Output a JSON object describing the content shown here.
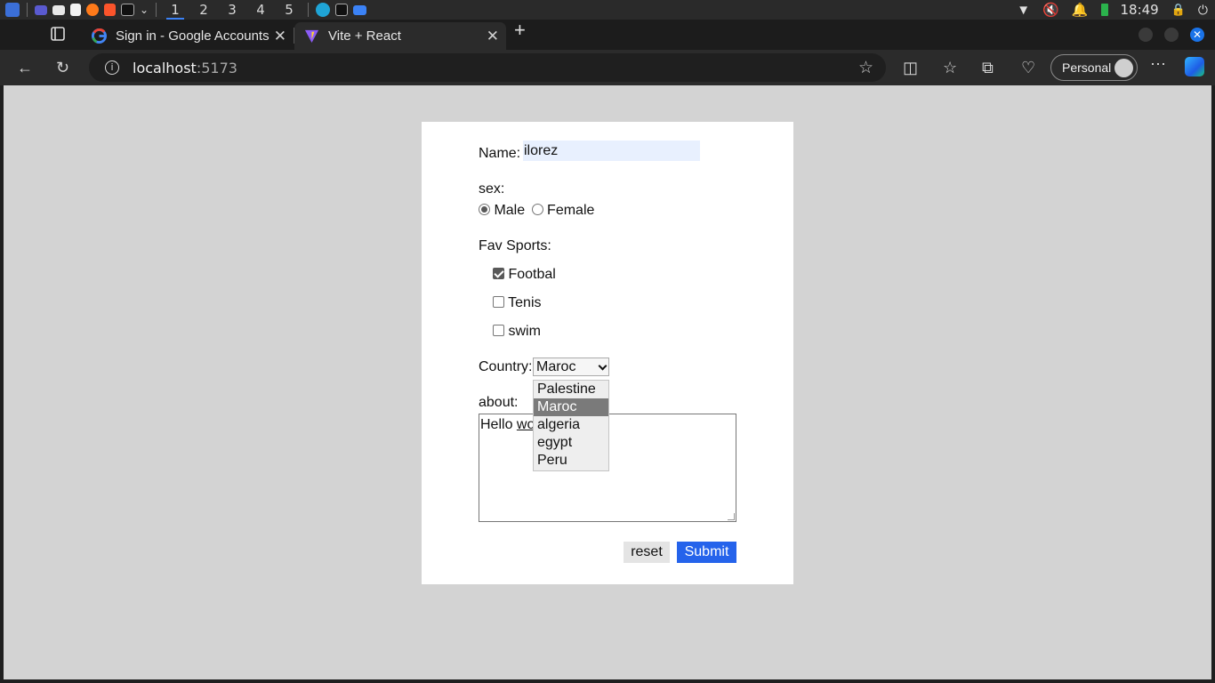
{
  "os": {
    "workspaces": [
      "1",
      "2",
      "3",
      "4",
      "5"
    ],
    "active_workspace": "1",
    "clock": "18:49"
  },
  "browser": {
    "tabs": [
      {
        "title": "Sign in - Google Accounts",
        "icon": "google-icon"
      },
      {
        "title": "Vite + React",
        "icon": "vite-icon"
      }
    ],
    "address": {
      "host": "localhost",
      "port": ":5173"
    },
    "profile_label": "Personal"
  },
  "form": {
    "name_label": "Name:",
    "name_value": "ilorez",
    "sex_label": "sex:",
    "sex_options": [
      "Male",
      "Female"
    ],
    "sex_selected": "Male",
    "sports_label": "Fav Sports:",
    "sports": [
      {
        "label": "Footbal",
        "checked": true
      },
      {
        "label": "Tenis",
        "checked": false
      },
      {
        "label": "swim",
        "checked": false
      }
    ],
    "country_label": "Country:",
    "country_selected": "Maroc",
    "country_options": [
      "Palestine",
      "Maroc",
      "algeria",
      "egypt",
      "Peru"
    ],
    "about_label": "about:",
    "about_prefix": "Hello ",
    "about_underlined": "wo",
    "reset_label": "reset",
    "submit_label": "Submit"
  },
  "colors": {
    "submit_bg": "#2563eb",
    "page_bg": "#d3d3d3",
    "autofill_bg": "#e8f0fe"
  }
}
